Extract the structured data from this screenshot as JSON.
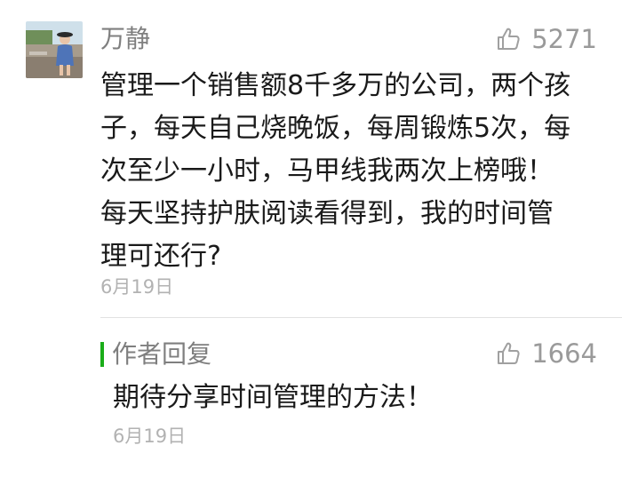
{
  "comment": {
    "author": "万静",
    "likes": "5271",
    "text": "管理一个销售额8千多万的公司，两个孩\n子，每天自己烧晚饭，每周锻炼5次，每\n次至少一小时，马甲线我两次上榜哦！\n每天坚持护肤阅读看得到，我的时间管\n理可还行?",
    "date": "6月19日"
  },
  "reply": {
    "label": "作者回复",
    "likes": "1664",
    "text": "期待分享时间管理的方法！",
    "date": "6月19日"
  },
  "icons": {
    "avatar": "user-photo",
    "like": "thumbs-up-icon"
  },
  "colors": {
    "accent": "#1aad19",
    "name": "#7f7f7f",
    "body": "#1a1a1a",
    "meta": "#b2b2b2"
  }
}
